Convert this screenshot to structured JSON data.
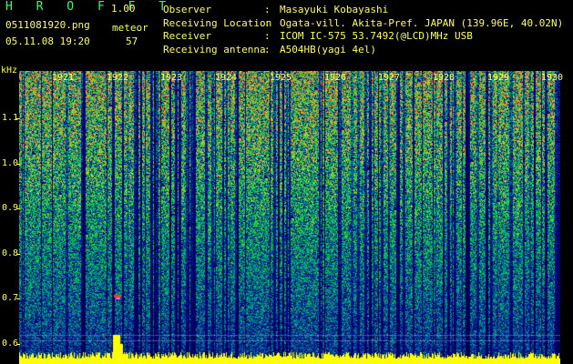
{
  "header": {
    "app_title": "H R O F F T",
    "version": "1.00",
    "filename": "0511081920.png",
    "datetime": "05.11.08 19:20",
    "meteor_label": "meteor",
    "meteor_count": "57"
  },
  "info": [
    {
      "label": "Observer",
      "value": "Masayuki Kobayashi"
    },
    {
      "label": "Receiving Location",
      "value": "Ogata-vill. Akita-Pref. JAPAN (139.96E, 40.02N)"
    },
    {
      "label": "Receiver",
      "value": "ICOM IC-575 53.7492(@LCD)MHz USB"
    },
    {
      "label": "Receiving antenna",
      "value": "A504HB(yagi 4el)"
    }
  ],
  "axis": {
    "y_unit": "kHz",
    "y_labels": [
      "1.1",
      "1.0",
      "0.9",
      "0.8",
      "0.7",
      "0.6"
    ],
    "x_labels": [
      "1921",
      "1922",
      "1923",
      "1924",
      "1925",
      "1926",
      "1927",
      "1928",
      "1929",
      "1930"
    ]
  }
}
